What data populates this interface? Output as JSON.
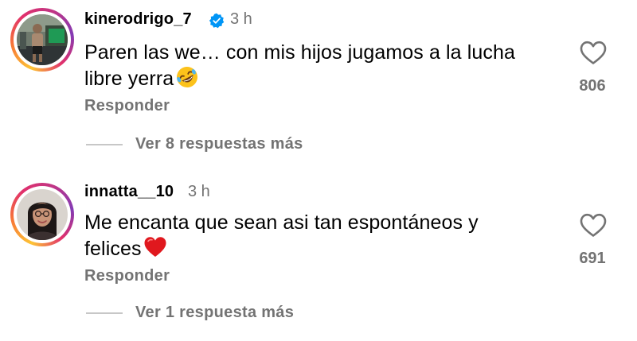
{
  "comments": [
    {
      "username": "kinerodrigo_7",
      "verified": true,
      "timestamp": "3 h",
      "text_line1": "Paren las we… con mis hijos jugamos a la lucha",
      "text_line2": "libre yerra",
      "emoji": "rolling-on-the-floor-laughing-icon",
      "reply_label": "Responder",
      "view_replies_label": "Ver 8 respuestas más",
      "likes": "806"
    },
    {
      "username": "innatta__10",
      "verified": false,
      "timestamp": "3 h",
      "text_line1": "Me encanta que sean asi tan espontáneos y",
      "text_line2": "felices",
      "emoji": "red-heart-icon",
      "reply_label": "Responder",
      "view_replies_label": "Ver 1 respuesta más",
      "likes": "691"
    }
  ],
  "colors": {
    "text": "#000000",
    "secondary": "#737373",
    "verified_blue": "#0095f6",
    "divider": "#c7c7c7",
    "heart_emoji": "#e0181e"
  },
  "icons": {
    "like": "heart-outline-icon",
    "verified": "verified-badge-icon"
  }
}
